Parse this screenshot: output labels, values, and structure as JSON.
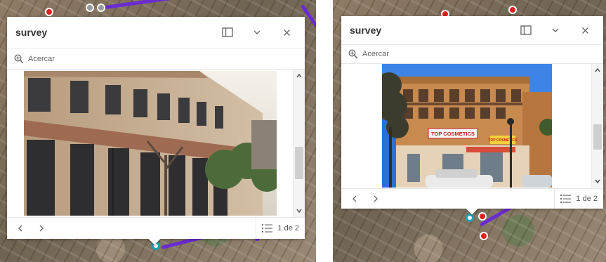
{
  "colors": {
    "route": "#6a2bd1",
    "marker_red": "#e02020",
    "marker_teal": "#1ba3b3",
    "popup_bg": "#ffffff",
    "icon": "#6b6b6b"
  },
  "panels": [
    {
      "popup": {
        "title": "survey",
        "dock_icon": "dock-icon",
        "collapse_icon": "chevron-down-icon",
        "close_icon": "close-icon",
        "zoom_icon": "zoom-in-icon",
        "zoom_label": "Acercar",
        "prev_icon": "chevron-left-icon",
        "next_icon": "chevron-right-icon",
        "list_icon": "feature-list-icon",
        "pager_text": "1 de 2",
        "photo": "building-photo"
      }
    },
    {
      "popup": {
        "title": "survey",
        "dock_icon": "dock-icon",
        "collapse_icon": "chevron-down-icon",
        "close_icon": "close-icon",
        "zoom_icon": "zoom-in-icon",
        "zoom_label": "Acercar",
        "prev_icon": "chevron-left-icon",
        "next_icon": "chevron-right-icon",
        "list_icon": "feature-list-icon",
        "pager_text": "1 de 2",
        "photo": "storefront-photo",
        "storefront_signs": [
          "TOP COSMETICS",
          "TOP COSMETICS"
        ]
      }
    }
  ]
}
